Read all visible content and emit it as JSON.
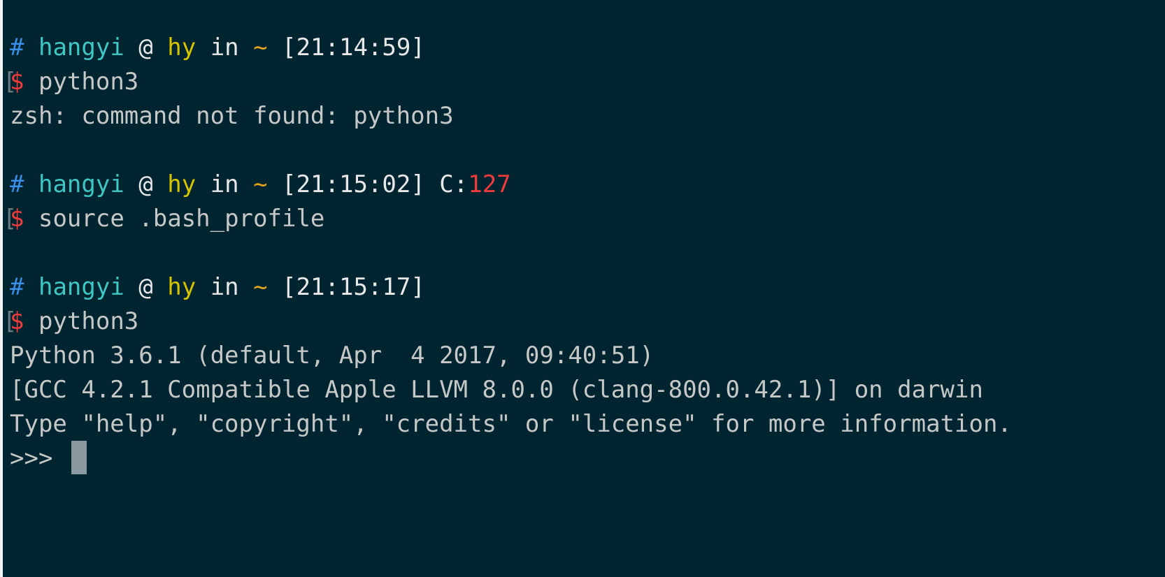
{
  "theme": {
    "background": "#002430",
    "prompt_hash_color": "#3a8ee6",
    "user_color": "#3fc7c4",
    "host_color": "#d7c300",
    "path_color": "#e3a31b",
    "error_code_color": "#ef3b3b",
    "dollar_color": "#ef3b3b"
  },
  "session": {
    "prompts": [
      {
        "hash": "#",
        "user": "hangyi",
        "at": "@",
        "host": "hy",
        "in": "in",
        "path": "~",
        "time": "[21:14:59]",
        "exit_label": "",
        "exit_code": "",
        "dollar": "$",
        "command": "python3"
      },
      {
        "hash": "#",
        "user": "hangyi",
        "at": "@",
        "host": "hy",
        "in": "in",
        "path": "~",
        "time": "[21:15:02]",
        "exit_label": "C:",
        "exit_code": "127",
        "dollar": "$",
        "command": "source .bash_profile"
      },
      {
        "hash": "#",
        "user": "hangyi",
        "at": "@",
        "host": "hy",
        "in": "in",
        "path": "~",
        "time": "[21:15:17]",
        "exit_label": "",
        "exit_code": "",
        "dollar": "$",
        "command": "python3"
      }
    ],
    "outputs": {
      "error_1": "zsh: command not found: python3",
      "python_banner_1": "Python 3.6.1 (default, Apr  4 2017, 09:40:51)",
      "python_banner_2": "[GCC 4.2.1 Compatible Apple LLVM 8.0.0 (clang-800.0.42.1)] on darwin",
      "python_banner_3": "Type \"help\", \"copyright\", \"credits\" or \"license\" for more information.",
      "repl_prompt": ">>>"
    },
    "bracket_mark": "["
  }
}
